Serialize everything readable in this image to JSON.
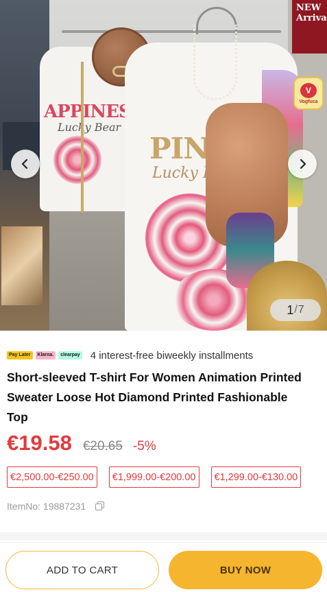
{
  "gallery": {
    "current": "1",
    "separator": "/",
    "total": "7",
    "poster_line1": "NEW",
    "poster_line2": "Arrival",
    "garment_text_small": "APPINESS",
    "garment_text_small2": "Lucky Bear",
    "garment_text_main": "PINESS",
    "garment_text_main2": "Lucky Bear",
    "logo_word": "Vogfuca"
  },
  "payment": {
    "badges": [
      "Pay Later",
      "Klarna.",
      "clearpay"
    ],
    "installment_text": "4 interest-free biweekly installments"
  },
  "product": {
    "title": "Short-sleeved T-shirt For Women Animation Printed Sweater Loose Hot Diamond Printed Fashionable Top",
    "price": "€19.58",
    "original_price": "€20.65",
    "discount": "-5%",
    "coupons": [
      "€2,500.00-€250.00",
      "€1,999.00-€200.00",
      "€1,299.00-€130.00"
    ],
    "item_no": "ItemNo: 19887231"
  },
  "actions": {
    "add_to_cart": "ADD TO CART",
    "buy_now": "BUY NOW"
  },
  "colors": {
    "accent_red": "#e4393c",
    "buy_yellow": "#f5b52f",
    "cart_border": "#f3b73a"
  }
}
